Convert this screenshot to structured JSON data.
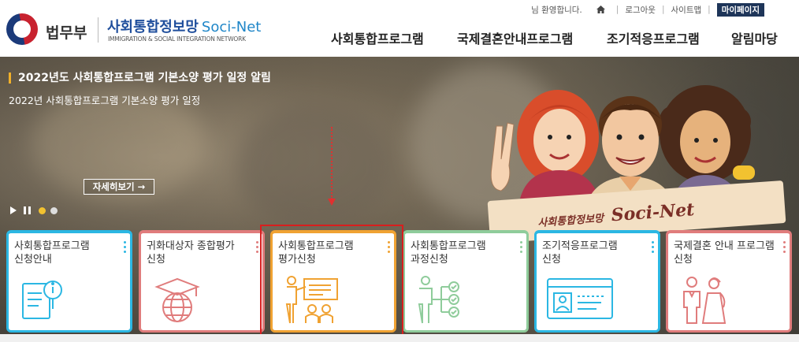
{
  "header": {
    "ministry": "법무부",
    "site_name_kr": "사회통합정보망",
    "site_name_en": "Soci-Net",
    "site_sub": "IMMIGRATION & SOCIAL INTEGRATION NETWORK",
    "greeting": "님 환영합니다.",
    "logout": "로그아웃",
    "sitemap": "사이트맵",
    "mypage": "마이페이지",
    "separator": "|",
    "nav": [
      "사회통합프로그램",
      "국제결혼안내프로그램",
      "조기적응프로그램",
      "알림마당"
    ]
  },
  "banner": {
    "title": "2022년도 사회통합프로그램 기본소양 평가 일정 알림",
    "subtitle": "2022년 사회통합프로그램 기본소양 평가 일정",
    "more_button": "자세히보기 →",
    "illustration_kr": "사회통합정보망",
    "illustration_en": "Soci-Net",
    "slide_count": 2,
    "active_slide": 1
  },
  "cards": [
    {
      "line1": "사회통합프로그램",
      "line2": "신청안내",
      "color": "#2bb7e3",
      "icon": "book-info-icon"
    },
    {
      "line1": "귀화대상자 종합평가",
      "line2": "신청",
      "color": "#e07c7c",
      "icon": "globe-graduation-icon"
    },
    {
      "line1": "사회통합프로그램",
      "line2": "평가신청",
      "color": "#f0a232",
      "icon": "presentation-teacher-icon"
    },
    {
      "line1": "사회통합프로그램",
      "line2": "과정신청",
      "color": "#8fcc9b",
      "icon": "process-checklist-icon"
    },
    {
      "line1": "조기적응프로그램",
      "line2": "신청",
      "color": "#2bb7e3",
      "icon": "id-card-icon"
    },
    {
      "line1": "국제결혼 안내 프로그램",
      "line2": "신청",
      "color": "#e07c7c",
      "icon": "wedding-couple-icon"
    }
  ],
  "colors": {
    "highlight": "#d81e1e",
    "accent": "#f1b02a",
    "mypage_bg": "#1e3559"
  }
}
